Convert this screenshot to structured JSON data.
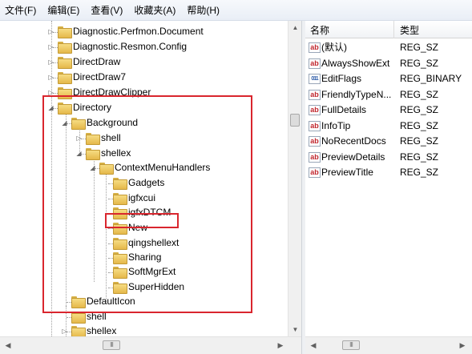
{
  "menu": [
    "文件(F)",
    "编辑(E)",
    "查看(V)",
    "收藏夹(A)",
    "帮助(H)"
  ],
  "tree": [
    {
      "label": "Diagnostic.Perfmon.Document",
      "expander": "▷"
    },
    {
      "label": "Diagnostic.Resmon.Config",
      "expander": "▷"
    },
    {
      "label": "DirectDraw",
      "expander": "▷"
    },
    {
      "label": "DirectDraw7",
      "expander": "▷"
    },
    {
      "label": "DirectDrawClipper",
      "expander": "▷"
    },
    {
      "label": "Directory",
      "expander": "◢"
    },
    {
      "label": "Background",
      "expander": "◢"
    },
    {
      "label": "shell",
      "expander": "▷"
    },
    {
      "label": "shellex",
      "expander": "◢"
    },
    {
      "label": "ContextMenuHandlers",
      "expander": "◢"
    },
    {
      "label": "Gadgets",
      "expander": ""
    },
    {
      "label": "igfxcui",
      "expander": ""
    },
    {
      "label": "igfxDTCM",
      "expander": ""
    },
    {
      "label": "New",
      "expander": ""
    },
    {
      "label": "qingshellext",
      "expander": ""
    },
    {
      "label": "Sharing",
      "expander": ""
    },
    {
      "label": "SoftMgrExt",
      "expander": ""
    },
    {
      "label": "SuperHidden",
      "expander": ""
    },
    {
      "label": "DefaultIcon",
      "expander": ""
    },
    {
      "label": "shell",
      "expander": ""
    },
    {
      "label": "shellex",
      "expander": "▷"
    }
  ],
  "list": {
    "headers": {
      "name": "名称",
      "type": "类型"
    },
    "rows": [
      {
        "name": "(默认)",
        "type": "REG_SZ",
        "icon": "ab"
      },
      {
        "name": "AlwaysShowExt",
        "type": "REG_SZ",
        "icon": "ab"
      },
      {
        "name": "EditFlags",
        "type": "REG_BINARY",
        "icon": "011"
      },
      {
        "name": "FriendlyTypeN...",
        "type": "REG_SZ",
        "icon": "ab"
      },
      {
        "name": "FullDetails",
        "type": "REG_SZ",
        "icon": "ab"
      },
      {
        "name": "InfoTip",
        "type": "REG_SZ",
        "icon": "ab"
      },
      {
        "name": "NoRecentDocs",
        "type": "REG_SZ",
        "icon": "ab"
      },
      {
        "name": "PreviewDetails",
        "type": "REG_SZ",
        "icon": "ab"
      },
      {
        "name": "PreviewTitle",
        "type": "REG_SZ",
        "icon": "ab"
      }
    ]
  },
  "scroll_grip": "III",
  "colors": {
    "highlight": "#d9262e"
  }
}
